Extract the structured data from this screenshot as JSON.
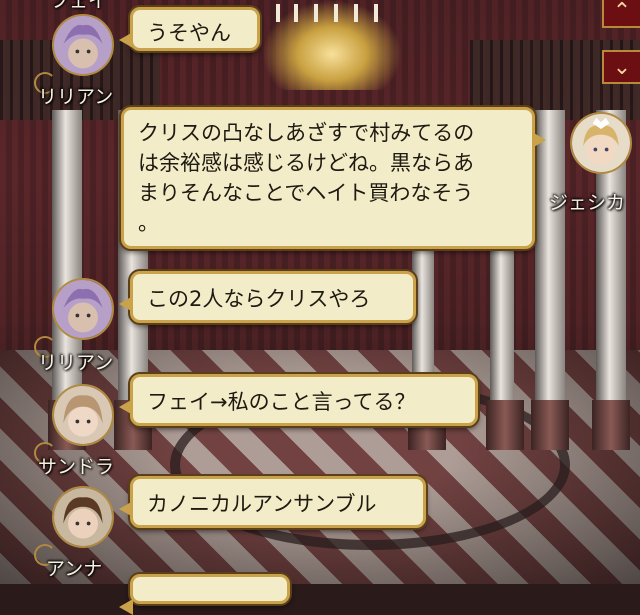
{
  "messages": [
    {
      "speaker": "フェイ",
      "text": "うそやん",
      "side": "left"
    },
    {
      "speaker": "リリアン",
      "text": "",
      "side": "left"
    },
    {
      "speaker": "ジェシカ",
      "text": "クリスの凸なしあざすで村みてるのは余裕感は感じるけどね。黒ならあまりそんなことでヘイト買わなそう。",
      "side": "right"
    },
    {
      "speaker": "リリアン",
      "text": "この2人ならクリスやろ",
      "side": "left"
    },
    {
      "speaker": "サンドラ",
      "text": "フェイ→私のこと言ってる？",
      "side": "left"
    },
    {
      "speaker": "アンナ",
      "text": "カノニカルアンサンブル",
      "side": "left"
    }
  ],
  "bubbles": {
    "b1": "うそやん",
    "b2_line1": "クリスの凸なしあざすで村みてるの",
    "b2_line2": "は余裕感は感じるけどね。黒ならあ",
    "b2_line3": "まりそんなことでヘイト買わなそう",
    "b2_line4": "。",
    "b3": "この2人ならクリスやろ",
    "b4": "フェイ→私のこと言ってる？",
    "b5": "カノニカルアンサンブル"
  },
  "names": {
    "top_partial": "フェイ",
    "lilian_1": "リリアン",
    "jessica": "ジェシカ",
    "lilian_2": "リリアン",
    "sandra": "サンドラ",
    "anna": "アンナ"
  },
  "icons": {
    "side_up": "chevron-up-icon",
    "side_down": "chevron-down-icon"
  },
  "colors": {
    "bubble_fill": "#f3ecc8",
    "bubble_border": "#c9a24a",
    "side_button": "#6b0f12"
  }
}
